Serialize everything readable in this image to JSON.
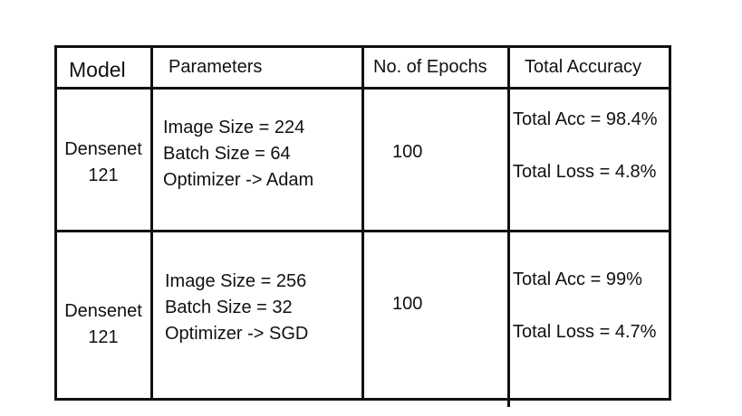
{
  "table": {
    "headers": {
      "model": "Model",
      "parameters": "Parameters",
      "epochs": "No. of Epochs",
      "accuracy": "Total Accuracy"
    },
    "rows": [
      {
        "model_line1": "Densenet",
        "model_line2": "121",
        "param_image_size": "Image Size = 224",
        "param_batch_size": "Batch Size  = 64",
        "param_optimizer": "Optimizer  -> Adam",
        "epochs": "100",
        "total_acc": "Total Acc = 98.4%",
        "total_loss": "Total Loss = 4.8%"
      },
      {
        "model_line1": "Densenet",
        "model_line2": "121",
        "param_image_size": "Image Size =  256",
        "param_batch_size": "Batch Size  =  32",
        "param_optimizer": "Optimizer  -> SGD",
        "epochs": "100",
        "total_acc": "Total Acc = 99%",
        "total_loss": "Total Loss = 4.7%"
      }
    ]
  }
}
